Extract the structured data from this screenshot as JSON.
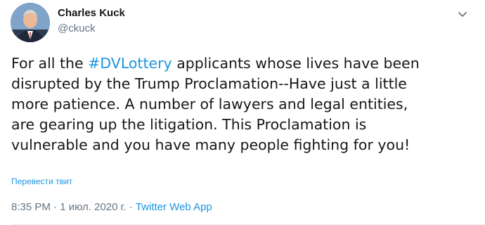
{
  "author": {
    "display_name": "Charles Kuck",
    "handle": "@ckuck"
  },
  "tweet": {
    "lines": [
      {
        "pre": "For all the ",
        "hashtag": "#DVLottery",
        "post": " applicants whose lives have been"
      },
      {
        "text": "disrupted by the Trump Proclamation--Have just a little"
      },
      {
        "text": "more patience.  A number of lawyers and legal entities,"
      },
      {
        "text": "are gearing up the litigation.  This Proclamation is"
      },
      {
        "text": "vulnerable and you have many people fighting for you!"
      }
    ]
  },
  "translate_label": "Перевести твит",
  "meta": {
    "time": "8:35 PM",
    "separator": " · ",
    "date": "1 июл. 2020 г.",
    "source": "Twitter Web App"
  },
  "colors": {
    "link": "#1b95e0",
    "secondary_text": "#657786",
    "primary_text": "#14171a"
  },
  "icons": {
    "more": "chevron-down-icon",
    "avatar": "avatar"
  }
}
